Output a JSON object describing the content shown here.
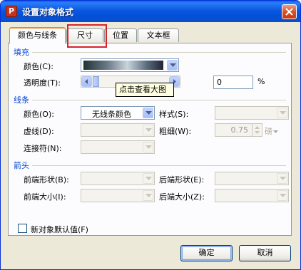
{
  "window": {
    "title": "设置对象格式",
    "app_icon_letter": "P"
  },
  "tabs": [
    {
      "label": "颜色与线条",
      "active": true
    },
    {
      "label": "尺寸",
      "active": false
    },
    {
      "label": "位置",
      "active": false
    },
    {
      "label": "文本框",
      "active": false
    }
  ],
  "fill": {
    "section_title": "填充",
    "color_label": "颜色(C):",
    "transparency_label": "透明度(T):",
    "transparency_value": "0",
    "transparency_unit": "%",
    "tooltip": "点击查看大图"
  },
  "line": {
    "section_title": "线条",
    "color_label": "颜色(O):",
    "color_value": "无线条颜色",
    "style_label": "样式(S):",
    "dash_label": "虚线(D):",
    "weight_label": "粗细(W):",
    "weight_value": "0.75",
    "weight_unit": "磅",
    "connector_label": "连接符(N):"
  },
  "arrows": {
    "section_title": "箭头",
    "begin_style_label": "前端形状(B):",
    "end_style_label": "后端形状(E):",
    "begin_size_label": "前端大小(I):",
    "end_size_label": "后端大小(Z):"
  },
  "default_checkbox_label": "新对象默认值(F)",
  "buttons": {
    "ok": "确定",
    "cancel": "取消"
  },
  "colors": {
    "accent": "#0046d5",
    "highlight": "#d8232a"
  }
}
